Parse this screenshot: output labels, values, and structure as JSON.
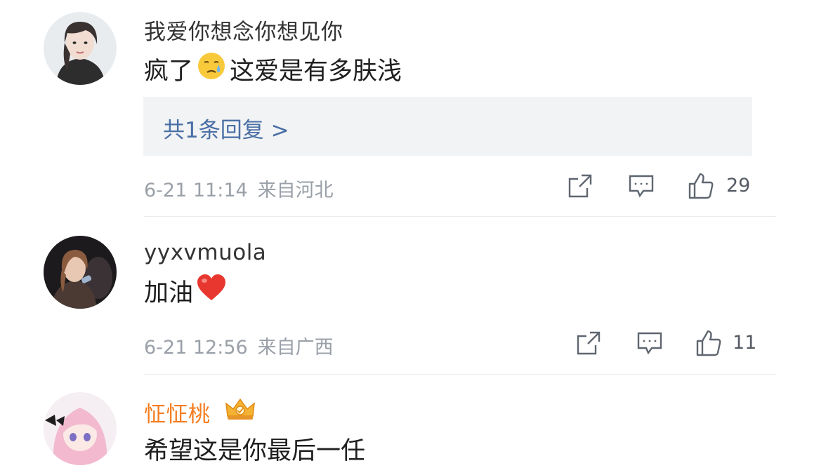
{
  "comments": [
    {
      "username": "我爱你想念你想见你",
      "text_before_emoji": "疯了",
      "emoji": "sweat-tear-emoji",
      "text_after_emoji": "这爱是有多肤浅",
      "replies_label": "共1条回复 >",
      "date": "6-21 11:14",
      "location": "来自河北",
      "likes": "29"
    },
    {
      "username": "yyxvmuola",
      "text_before_emoji": "加油",
      "emoji": "red-heart-emoji",
      "date": "6-21 12:56",
      "location": "来自广西",
      "likes": "11"
    },
    {
      "username": "怔怔桃",
      "badge": "crown-vip-badge",
      "text_before_emoji": "希望这是你最后一任"
    }
  ],
  "colors": {
    "username": "#333333",
    "vip_username": "#f57d1f",
    "reply_link": "#4a6fa5",
    "reply_box_bg": "#f2f3f5",
    "meta_text": "#9aa0a8",
    "icon_stroke": "#5f6670"
  },
  "icons": [
    "share-icon",
    "comment-icon",
    "like-icon"
  ]
}
